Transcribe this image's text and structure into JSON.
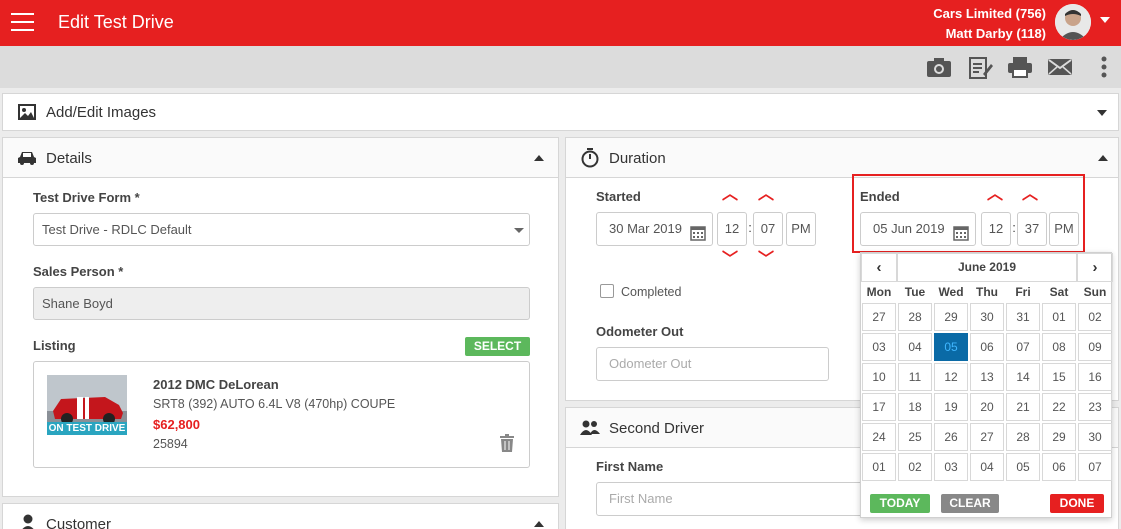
{
  "header": {
    "title": "Edit Test Drive",
    "company": "Cars Limited (756)",
    "user": "Matt Darby (118)"
  },
  "toolbar": {
    "icons": [
      "camera-icon",
      "notes-icon",
      "print-icon",
      "email-icon",
      "more-vertical-icon"
    ]
  },
  "images_panel": {
    "title": "Add/Edit Images"
  },
  "details": {
    "title": "Details",
    "form_label": "Test Drive Form *",
    "form_value": "Test Drive - RDLC Default",
    "sales_label": "Sales Person *",
    "sales_value": "Shane Boyd",
    "listing_label": "Listing",
    "select_label": "SELECT",
    "listing": {
      "name": "2012 DMC DeLorean",
      "spec": "SRT8 (392) AUTO 6.4L V8 (470hp) COUPE",
      "price": "$62,800",
      "stock": "25894",
      "status": "ON TEST DRIVE"
    }
  },
  "customer": {
    "title": "Customer"
  },
  "duration": {
    "title": "Duration",
    "started_label": "Started",
    "started_date": "30 Mar 2019",
    "started_hour": "12",
    "started_min": "07",
    "started_ampm": "PM",
    "ended_label": "Ended",
    "ended_date": "05 Jun 2019",
    "ended_hour": "12",
    "ended_min": "37",
    "ended_ampm": "PM",
    "completed_label": "Completed",
    "odometer_label": "Odometer Out",
    "odometer_placeholder": "Odometer Out"
  },
  "second_driver": {
    "title": "Second Driver",
    "first_name_label": "First Name",
    "first_name_placeholder": "First Name"
  },
  "calendar": {
    "month": "June 2019",
    "days": [
      "Mon",
      "Tue",
      "Wed",
      "Thu",
      "Fri",
      "Sat",
      "Sun"
    ],
    "weeks": [
      [
        "27",
        "28",
        "29",
        "30",
        "31",
        "01",
        "02"
      ],
      [
        "03",
        "04",
        "05",
        "06",
        "07",
        "08",
        "09"
      ],
      [
        "10",
        "11",
        "12",
        "13",
        "14",
        "15",
        "16"
      ],
      [
        "17",
        "18",
        "19",
        "20",
        "21",
        "22",
        "23"
      ],
      [
        "24",
        "25",
        "26",
        "27",
        "28",
        "29",
        "30"
      ],
      [
        "01",
        "02",
        "03",
        "04",
        "05",
        "06",
        "07"
      ]
    ],
    "selected": "05",
    "today_label": "TODAY",
    "clear_label": "CLEAR",
    "done_label": "DONE"
  },
  "colors": {
    "brand": "#e62020",
    "success": "#5cb85c",
    "selected": "#0a6aa6"
  }
}
